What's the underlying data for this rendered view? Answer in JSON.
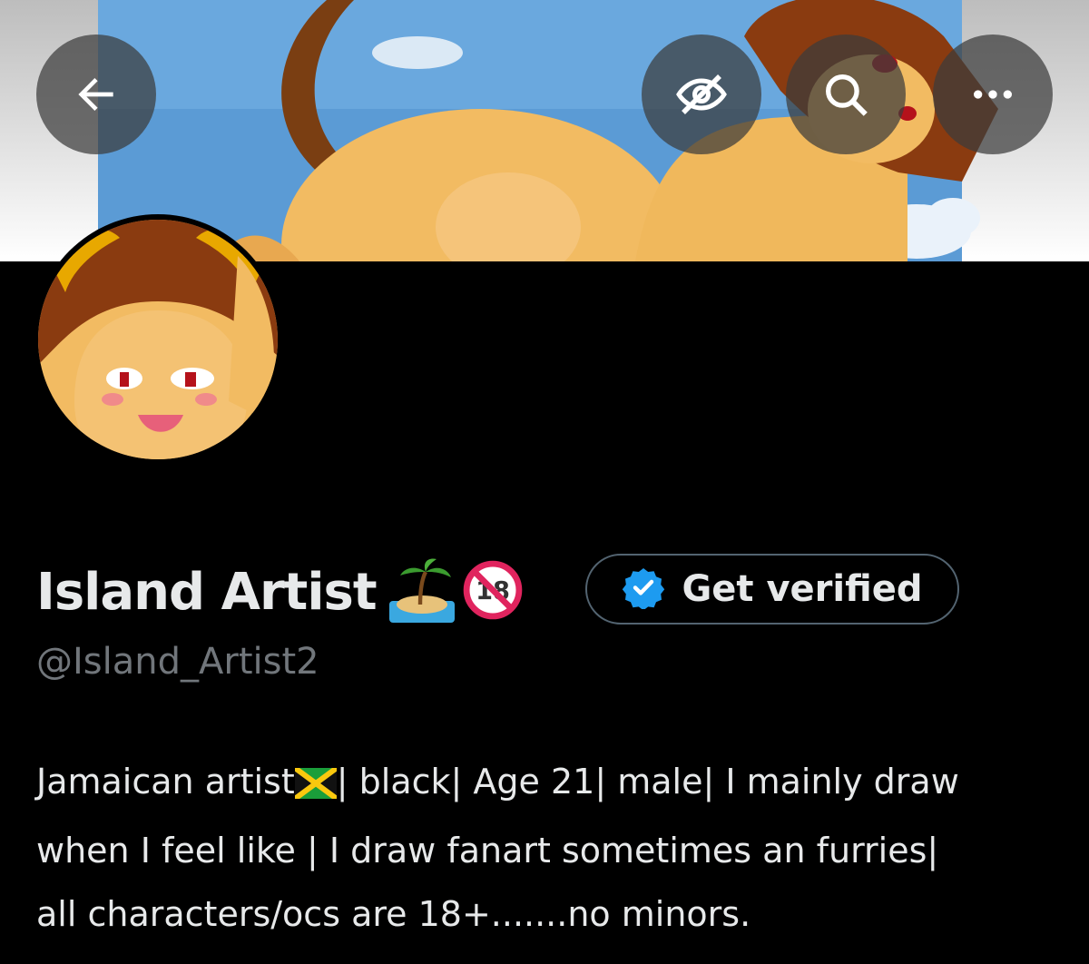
{
  "nav": {
    "back_icon": "arrow-left-icon",
    "nsfw_toggle_icon": "eye-slash-icon",
    "search_icon": "search-icon",
    "more_icon": "more-horizontal-icon"
  },
  "profile": {
    "display_name": "Island Artist",
    "name_emojis": [
      "island-icon",
      "no-under-18-icon"
    ],
    "handle": "@Island_Artist2",
    "bio_lines": [
      {
        "before_flag": "Jamaican artist",
        "after_flag": "| black| Age 21| male| I mainly draw"
      },
      {
        "text": "when I feel like | I draw fanart sometimes an furries|"
      },
      {
        "text": "all characters/ocs are 18+.......no minors."
      }
    ]
  },
  "verify": {
    "label": "Get verified",
    "icon": "verified-badge-icon",
    "badge_color": "#1d9bf0"
  },
  "colors": {
    "background": "#000000",
    "text_primary": "#e7e9ea",
    "text_secondary": "#71767b",
    "button_border": "#536471"
  }
}
